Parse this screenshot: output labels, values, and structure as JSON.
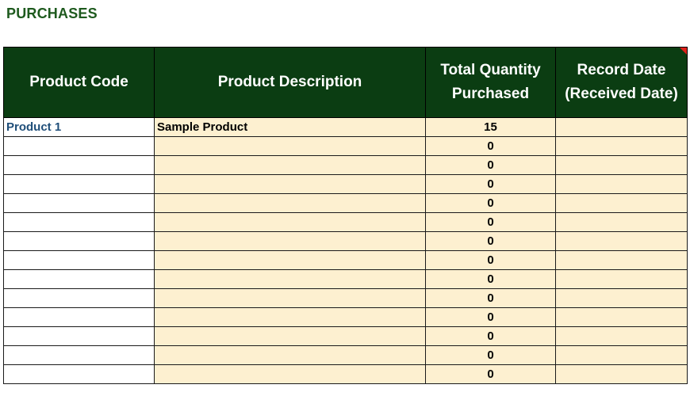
{
  "title": "PURCHASES",
  "table": {
    "headers": {
      "code": "Product Code",
      "description": "Product Description",
      "quantity_line1": "Total Quantity",
      "quantity_line2": "Purchased",
      "date_line1": "Record Date",
      "date_line2": "(Received Date)"
    },
    "rows": [
      {
        "code": "Product 1",
        "description": "Sample Product",
        "quantity": "15",
        "date": ""
      },
      {
        "code": "",
        "description": "",
        "quantity": "0",
        "date": ""
      },
      {
        "code": "",
        "description": "",
        "quantity": "0",
        "date": ""
      },
      {
        "code": "",
        "description": "",
        "quantity": "0",
        "date": ""
      },
      {
        "code": "",
        "description": "",
        "quantity": "0",
        "date": ""
      },
      {
        "code": "",
        "description": "",
        "quantity": "0",
        "date": ""
      },
      {
        "code": "",
        "description": "",
        "quantity": "0",
        "date": ""
      },
      {
        "code": "",
        "description": "",
        "quantity": "0",
        "date": ""
      },
      {
        "code": "",
        "description": "",
        "quantity": "0",
        "date": ""
      },
      {
        "code": "",
        "description": "",
        "quantity": "0",
        "date": ""
      },
      {
        "code": "",
        "description": "",
        "quantity": "0",
        "date": ""
      },
      {
        "code": "",
        "description": "",
        "quantity": "0",
        "date": ""
      },
      {
        "code": "",
        "description": "",
        "quantity": "0",
        "date": ""
      },
      {
        "code": "",
        "description": "",
        "quantity": "0",
        "date": ""
      }
    ]
  },
  "colors": {
    "header_bg": "#0b3d12",
    "title_text": "#1e5a1e",
    "input_cell_bg": "#fdf0d0",
    "code_text": "#1f4e79",
    "comment_marker": "#e0211b"
  }
}
